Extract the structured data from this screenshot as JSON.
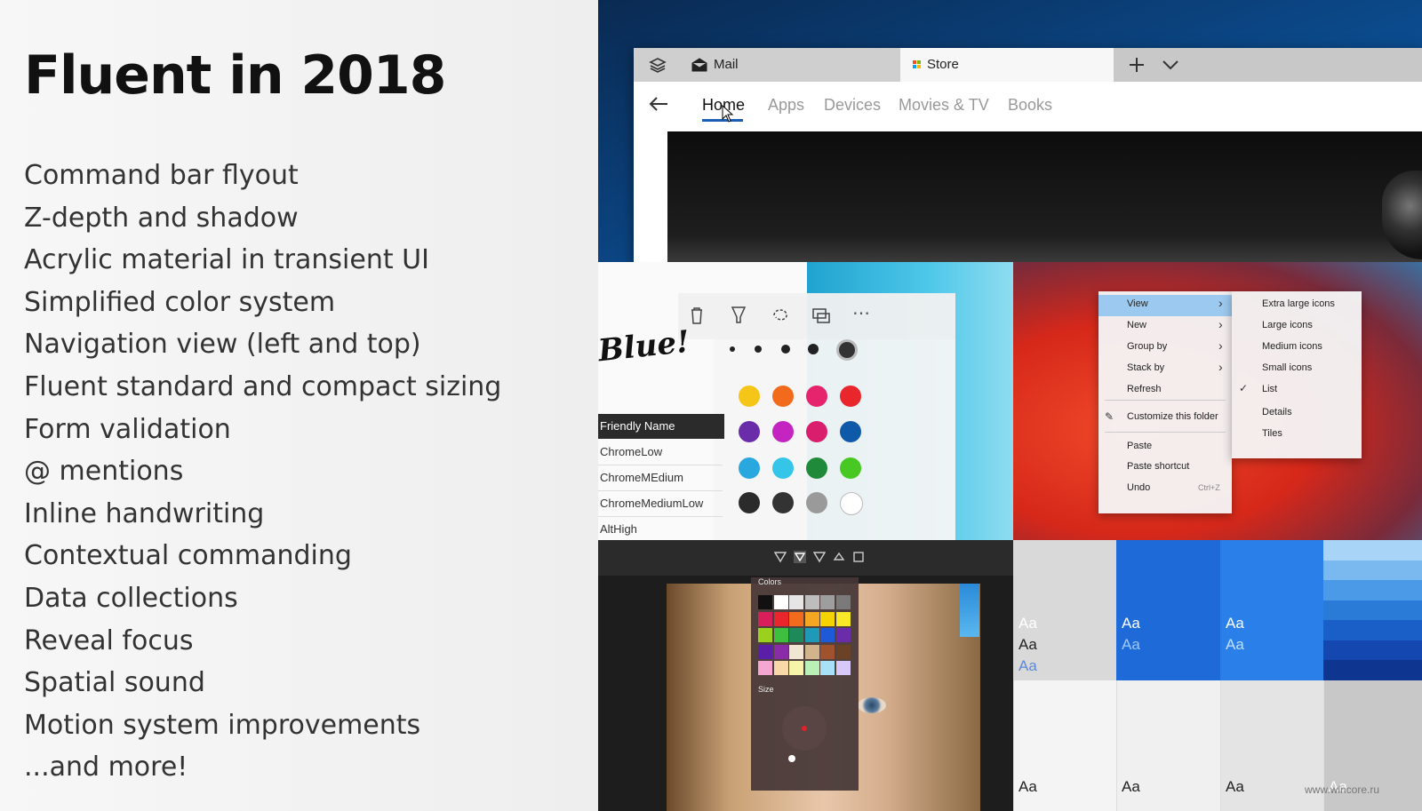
{
  "slide": {
    "title": "Fluent in 2018",
    "features": [
      "Command bar flyout",
      "Z-depth and shadow",
      "Acrylic material in transient UI",
      "Simplified color system",
      "Navigation view (left and top)",
      "Fluent standard and compact sizing",
      "Form validation",
      "@ mentions",
      "Inline handwriting",
      "Contextual commanding",
      "Data collections",
      "Reveal focus",
      "Spatial sound",
      "Motion system improvements",
      "...and more!"
    ]
  },
  "store": {
    "tabs": [
      "Mail",
      "Store"
    ],
    "nav": [
      "Home",
      "Apps",
      "Devices",
      "Movies & TV",
      "Books"
    ],
    "active_nav": "Home"
  },
  "ink": {
    "handwriting": "Blue!",
    "list_header": "Friendly Name",
    "list_items": [
      "ChromeLow",
      "ChromeMEdium",
      "ChromeMediumLow",
      "AltHigh"
    ],
    "colors": [
      "#f5c518",
      "#f26b1d",
      "#e6246e",
      "#e8262b",
      "#6a2ca8",
      "#c425c0",
      "#d81e6c",
      "#0f5aa8",
      "#29a8e0",
      "#34c5e8",
      "#1e8a3a",
      "#47c823",
      "#2b2b2b",
      "#333333",
      "#9a9a9a",
      "#ffffff"
    ]
  },
  "context_menu": {
    "items": [
      {
        "label": "View",
        "chevron": "›"
      },
      {
        "label": "New",
        "chevron": "›"
      },
      {
        "label": "Group by",
        "chevron": "›"
      },
      {
        "label": "Stack by",
        "chevron": "›"
      },
      {
        "label": "Refresh",
        "chevron": ""
      },
      {
        "label": "Customize this folder",
        "chevron": ""
      },
      {
        "label": "Paste",
        "chevron": ""
      },
      {
        "label": "Paste shortcut",
        "chevron": ""
      },
      {
        "label": "Undo",
        "chevron": "",
        "shortcut": "Ctrl+Z"
      }
    ],
    "submenu": [
      "Extra large icons",
      "Large icons",
      "Medium icons",
      "Small icons",
      "List",
      "Details",
      "Tiles"
    ]
  },
  "photo_editor": {
    "flyout_title": "Colors",
    "size_label": "Size",
    "palette": [
      "#111111",
      "#ffffff",
      "#e6e6e6",
      "#bdbdbd",
      "#9e9e9e",
      "#7a7a7a",
      "#d81e5b",
      "#e8262b",
      "#f26b1d",
      "#f5a623",
      "#f5d300",
      "#f7e926",
      "#9ad11e",
      "#3fbf3f",
      "#1e8a5a",
      "#1e9ab8",
      "#1e5ad8",
      "#6a2ca8",
      "#5a1ea8",
      "#8a2ca8",
      "#f0e6d2",
      "#d2b48c",
      "#a0522d",
      "#6b4226",
      "#f4a7d0",
      "#f7d8a8",
      "#f7f3a8",
      "#b8f0b8",
      "#a8e0f7",
      "#d8c8f7"
    ]
  },
  "swatches": {
    "sample_text": "Aa"
  },
  "watermark": "www.wincore.ru"
}
